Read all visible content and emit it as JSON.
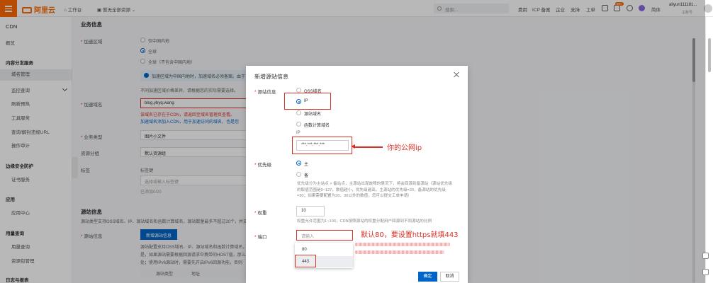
{
  "topbar": {
    "logo_text": "阿里云",
    "workbench": "工作台",
    "resource_switch": "暂无全部资源",
    "search_placeholder": "搜索...",
    "nav": [
      "费用",
      "ICP 备案",
      "企业",
      "支持",
      "工单"
    ],
    "badge": "99+",
    "language": "简体",
    "username": "aliyun111181...",
    "account_type": "主账号"
  },
  "sidebar": {
    "title": "CDN",
    "overview": "概览",
    "group_content": "内容分发服务",
    "items_content": [
      "域名管理",
      "监控查询",
      "刷新预热",
      "工具服务",
      "查询/解封违规URL",
      "操作审计"
    ],
    "group_security": "边缘安全防护",
    "items_security": [
      "证书服务"
    ],
    "group_app": "应用",
    "items_app": [
      "应用中心"
    ],
    "group_usage": "用量查询",
    "items_usage": [
      "用量查询",
      "资源包管理"
    ],
    "group_logs": "日志与报表"
  },
  "background": {
    "section_business": "业务信息",
    "label_region": "加速区域",
    "region_options": [
      "仅中国内地",
      "全球",
      "全球（不包含中国内地）"
    ],
    "info_text": "加速区域为中国内地时，加速域名必须备案。由于",
    "hint_region": "不同加速区域价格差异，请根据您的实际需要选择。",
    "label_domain": "加速域名",
    "domain_value": "blog.ybyq.wang",
    "domain_error": "该域名已存在于CDN，请返回至域名管理页查看。",
    "domain_hint": "加速域名添加入CDN，用于加速访问的域名，也是您",
    "label_business_type": "业务类型",
    "business_type_value": "图片小文件",
    "label_resource_group": "资源分组",
    "resource_group_value": "默认资源组",
    "label_tag": "标签",
    "tag_key": "标签键",
    "tag_placeholder": "选择或输入标签键",
    "tag_count": "已添加0/20",
    "section_origin": "源站信息",
    "origin_desc": "源站类型支持OSS域名、IP、源站域名和函数计算域名，源站数量最多不超过20个，并支",
    "label_origin": "源站信息",
    "add_origin_button": "新增源站信息",
    "origin_text_1": "源站配置支持OSS域名、IP、源站域名和函数计算域名，",
    "origin_text_2": "是，如果源站需要根据回源请求中携带的HOST值，那么",
    "origin_text_3": "处；使用IPv6源站时，需要先开启IPv6回源功能，否则",
    "col_origin_type": "源站类型",
    "col_address": "地址"
  },
  "modal": {
    "title": "新增源站信息",
    "label_origin": "源站信息",
    "origin_options": [
      "OSS域名",
      "IP",
      "源站域名",
      "函数计算域名"
    ],
    "ip_label": "IP",
    "ip_value": "***.***.***.***",
    "label_priority": "优先级",
    "priority_options": [
      "主",
      "备"
    ],
    "priority_help": "优先级分为主站点 > 备站点，主源站出现故障的情况下，将会回源到备源站（源站优先级的取值范围是0~127，数值越小，优先级越高，主源站的优先级=20，备源站的优先级=30；如果需要配置为20、30以外的数值，您可以提交工单申请）",
    "label_weight": "权重",
    "weight_value": "10",
    "weight_help": "权重允许范围为1~100，CDN按照源站的权重分配用户回源到不同源站的比例",
    "label_port": "端口",
    "port_placeholder": "请输入",
    "port_options": [
      "80",
      "443"
    ],
    "confirm_button": "确定",
    "cancel_button": "取消"
  },
  "annotations": {
    "public_ip": "你的公网ip",
    "port_note": "默认80，要设置https就填443"
  },
  "colors": {
    "brand": "#ff6a00",
    "primary": "#0064c8",
    "annotation": "#d93026"
  }
}
